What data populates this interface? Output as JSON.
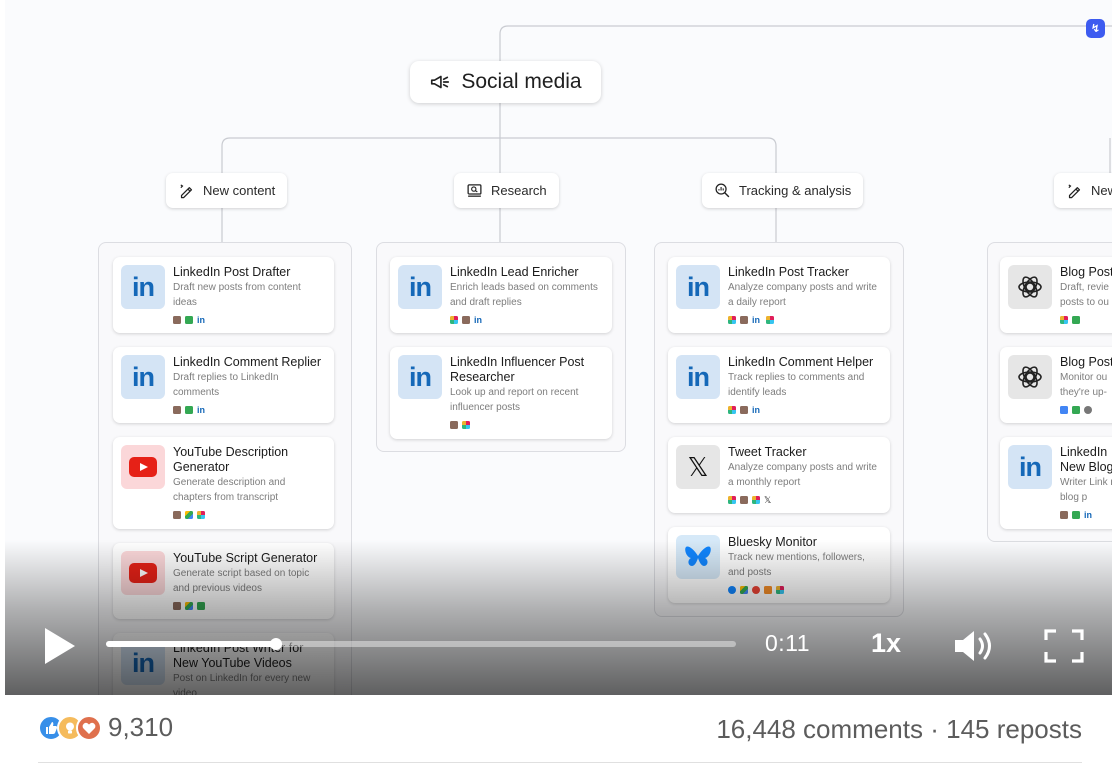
{
  "diagram": {
    "root": {
      "label": "Social media",
      "icon": "megaphone-icon"
    },
    "categories": [
      {
        "label": "New content",
        "icon": "pencil-spark-icon"
      },
      {
        "label": "Research",
        "icon": "screen-search-icon"
      },
      {
        "label": "Tracking & analysis",
        "icon": "magnifier-chart-icon"
      },
      {
        "label": "New",
        "icon": "pencil-spark-icon"
      }
    ],
    "columns": [
      {
        "cards": [
          {
            "title": "LinkedIn Post Drafter",
            "desc": "Draft new posts from content ideas",
            "logo": "linkedin",
            "tools": [
              "notion",
              "sheets",
              "linkedin"
            ]
          },
          {
            "title": "LinkedIn Comment Replier",
            "desc": "Draft replies to LinkedIn comments",
            "logo": "linkedin",
            "tools": [
              "notion",
              "sheets",
              "linkedin"
            ]
          },
          {
            "title": "YouTube Description Generator",
            "desc": "Generate description and chapters from transcript",
            "logo": "youtube",
            "tools": [
              "notion",
              "drive",
              "slack"
            ]
          },
          {
            "title": "YouTube Script Generator",
            "desc": "Generate script based on topic and previous videos",
            "logo": "youtube",
            "tools": [
              "notion",
              "drive",
              "sheets"
            ]
          },
          {
            "title": "LinkedIn Post Writer for New YouTube Videos",
            "desc": "Post on LinkedIn for every new video",
            "logo": "linkedin",
            "tools": []
          }
        ]
      },
      {
        "cards": [
          {
            "title": "LinkedIn Lead Enricher",
            "desc": "Enrich leads based on comments and draft replies",
            "logo": "linkedin",
            "tools": [
              "slack",
              "notion",
              "linkedin"
            ]
          },
          {
            "title": "LinkedIn Influencer Post Researcher",
            "desc": "Look up and report on recent influencer posts",
            "logo": "linkedin",
            "tools": [
              "notion",
              "slack"
            ]
          }
        ]
      },
      {
        "cards": [
          {
            "title": "LinkedIn Post Tracker",
            "desc": "Analyze company posts and write a daily report",
            "logo": "linkedin",
            "tools": [
              "slack",
              "notion",
              "linkedin",
              "slack"
            ]
          },
          {
            "title": "LinkedIn Comment Helper",
            "desc": "Track replies to comments and identify leads",
            "logo": "linkedin",
            "tools": [
              "slack",
              "notion",
              "linkedin"
            ]
          },
          {
            "title": "Tweet Tracker",
            "desc": "Analyze company posts and write a monthly report",
            "logo": "x",
            "tools": [
              "slack",
              "notion",
              "slack",
              "x"
            ]
          },
          {
            "title": "Bluesky Monitor",
            "desc": "Track new mentions, followers, and posts",
            "logo": "bluesky",
            "tools": [
              "bluesky",
              "drive",
              "gmail",
              "rss",
              "slack"
            ]
          }
        ]
      },
      {
        "cards": [
          {
            "title": "Blog Post",
            "desc": "Draft, revie posts to ou",
            "logo": "openai",
            "tools": [
              "slack",
              "sheets"
            ]
          },
          {
            "title": "Blog Post",
            "desc": "Monitor ou they're up-",
            "logo": "openai",
            "tools": [
              "docs",
              "sheets",
              "gear"
            ]
          },
          {
            "title": "LinkedIn New Blog",
            "desc": "Writer Link new blog p",
            "logo": "linkedin",
            "tools": [
              "notion",
              "sheets",
              "linkedin"
            ]
          }
        ]
      }
    ],
    "brand_icon": "relay-logo-icon"
  },
  "player": {
    "time": "0:11",
    "speed": "1x",
    "progress": 0.27
  },
  "social": {
    "reaction_count": "9,310",
    "comments": "16,448 comments",
    "separator": "·",
    "reposts": "145 reposts",
    "reactions": [
      "like-icon",
      "insightful-icon",
      "love-icon"
    ]
  },
  "colors": {
    "linkedin": "#1568b8",
    "youtube": "#e62117",
    "bluesky": "#1185fe",
    "brand": "#3d5bf0"
  }
}
